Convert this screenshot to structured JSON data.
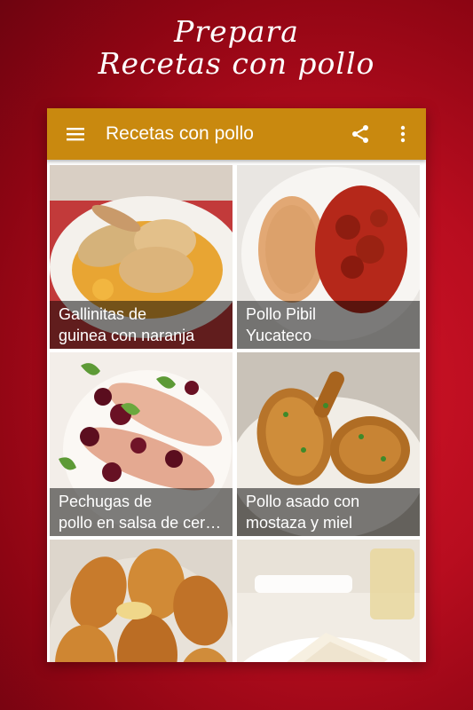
{
  "promo": {
    "line1": "Prepara",
    "line2": "Recetas con pollo"
  },
  "appbar": {
    "title": "Recetas con pollo",
    "background": "#c9890f",
    "icons": [
      "menu-icon",
      "share-icon",
      "more-vert-icon"
    ]
  },
  "recipes": [
    {
      "line1": "Gallinitas de",
      "line2": "guinea con naranja"
    },
    {
      "line1": "Pollo Pibil",
      "line2": "Yucateco"
    },
    {
      "line1": "Pechugas de",
      "line2": "pollo en salsa de cerezas"
    },
    {
      "line1": "Pollo asado con",
      "line2": "mostaza y miel"
    },
    {
      "line1": "",
      "line2": ""
    },
    {
      "line1": "",
      "line2": ""
    }
  ]
}
